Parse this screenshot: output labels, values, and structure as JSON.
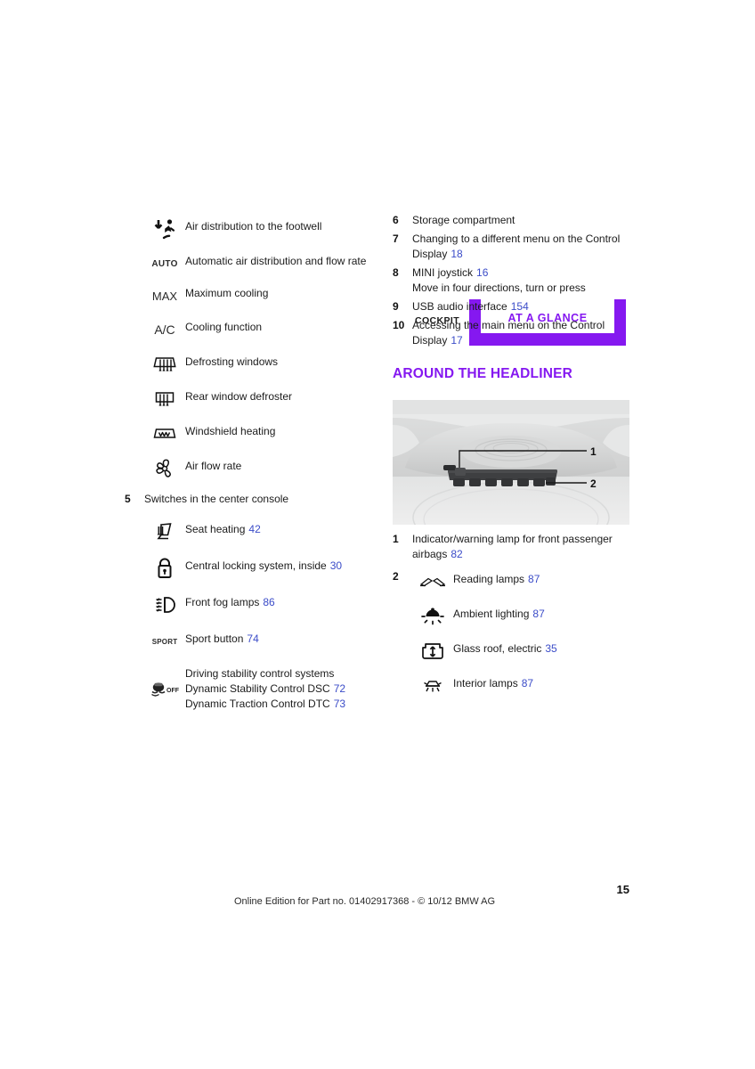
{
  "header": {
    "cockpit_label": "COCKPIT",
    "tab_label": "AT A GLANCE",
    "accent_color": "#8518f0"
  },
  "left_column": {
    "climate_symbols": [
      {
        "icon": "air-distribution-footwell-icon",
        "icon_text": "",
        "label": "Air distribution to the footwell"
      },
      {
        "icon": "auto-text-icon",
        "icon_text": "AUTO",
        "label": "Automatic air distribution and flow rate"
      },
      {
        "icon": "max-text-icon",
        "icon_text": "MAX",
        "label": "Maximum cooling"
      },
      {
        "icon": "ac-text-icon",
        "icon_text": "A/C",
        "label": "Cooling function"
      },
      {
        "icon": "defrosting-windows-icon",
        "icon_text": "",
        "label": "Defrosting windows"
      },
      {
        "icon": "rear-window-defroster-icon",
        "icon_text": "",
        "label": "Rear window defroster"
      },
      {
        "icon": "windshield-heating-icon",
        "icon_text": "",
        "label": "Windshield heating"
      },
      {
        "icon": "air-flow-rate-icon",
        "icon_text": "",
        "label": "Air flow rate"
      }
    ],
    "item5": {
      "number": "5",
      "label": "Switches in the center console"
    },
    "console_switches": [
      {
        "icon": "seat-heating-icon",
        "icon_text": "",
        "label": "Seat heating",
        "page": "42"
      },
      {
        "icon": "central-locking-icon",
        "icon_text": "",
        "label": "Central locking system, inside",
        "page": "30"
      },
      {
        "icon": "front-fog-lamps-icon",
        "icon_text": "",
        "label": "Front fog lamps",
        "page": "86"
      },
      {
        "icon": "sport-text-icon",
        "icon_text": "SPORT",
        "label": "Sport button",
        "page": "74"
      }
    ],
    "dsc_block": {
      "icon": "dsc-off-icon",
      "line1": "Driving stability control systems",
      "line2_label": "Dynamic Stability Control DSC",
      "line2_page": "72",
      "line3_label": "Dynamic Traction Control DTC",
      "line3_page": "73"
    }
  },
  "right_column": {
    "cockpit_items": [
      {
        "number": "6",
        "text": "Storage compartment",
        "page": ""
      },
      {
        "number": "7",
        "text": "Changing to a different menu on the Control Display",
        "page": "18"
      },
      {
        "number": "8",
        "text": "MINI joystick",
        "page": "16",
        "extra": "Move in four directions, turn or press"
      },
      {
        "number": "9",
        "text": "USB audio interface",
        "page": "154"
      },
      {
        "number": "10",
        "text": "Accessing the main menu on the Control Display",
        "page": "17"
      }
    ],
    "section_heading": "AROUND THE HEADLINER",
    "figure": {
      "name": "headliner-illustration",
      "callouts": [
        "1",
        "2"
      ]
    },
    "headliner_items": [
      {
        "number": "1",
        "text": "Indicator/warning lamp for front passenger airbags",
        "page": "82"
      },
      {
        "number": "2",
        "text": "",
        "page": ""
      }
    ],
    "headliner_icons": [
      {
        "icon": "reading-lamps-icon",
        "label": "Reading lamps",
        "page": "87"
      },
      {
        "icon": "ambient-lighting-icon",
        "label": "Ambient lighting",
        "page": "87"
      },
      {
        "icon": "glass-roof-electric-icon",
        "label": "Glass roof, electric",
        "page": "35"
      },
      {
        "icon": "interior-lamps-icon",
        "label": "Interior lamps",
        "page": "87"
      }
    ]
  },
  "footer": {
    "page_number": "15",
    "note": "Online Edition for Part no. 01402917368 - © 10/12 BMW AG"
  }
}
